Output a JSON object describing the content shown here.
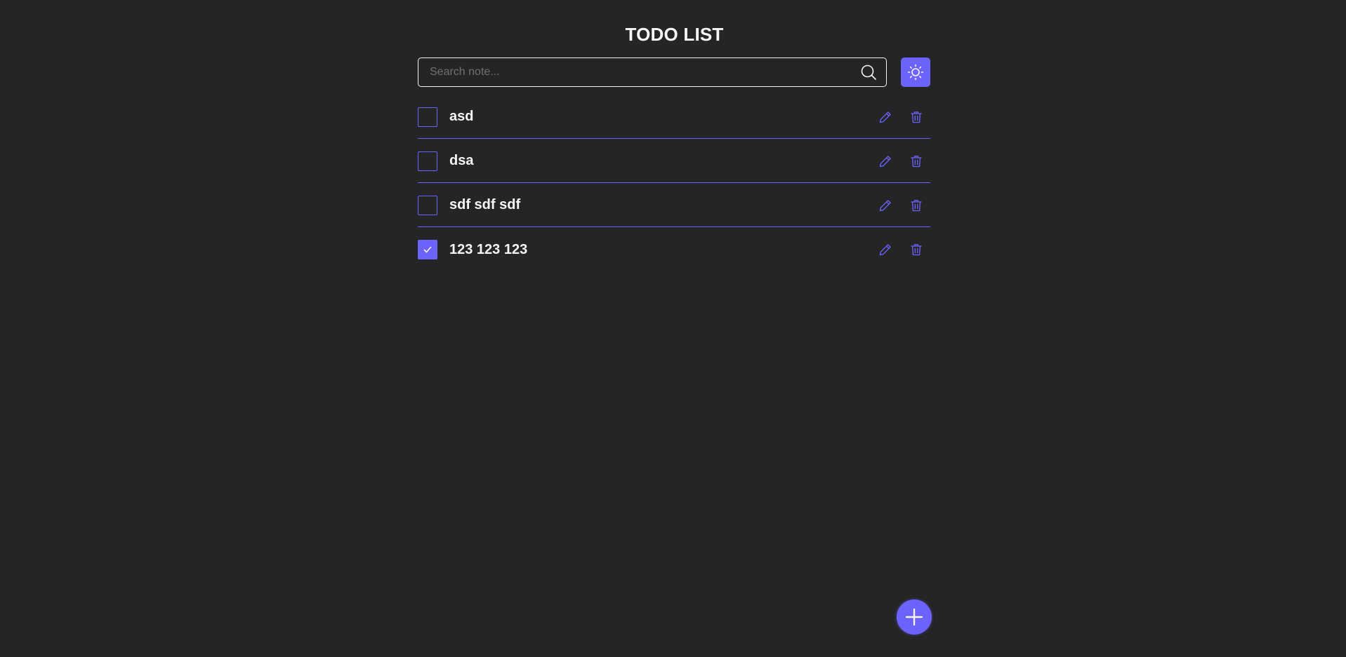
{
  "app": {
    "title": "TODO LIST"
  },
  "search": {
    "placeholder": "Search note...",
    "value": "",
    "icon": "search-icon"
  },
  "theme_toggle": {
    "icon": "sun-icon"
  },
  "todos": [
    {
      "label": "asd",
      "checked": false
    },
    {
      "label": "dsa",
      "checked": false
    },
    {
      "label": "sdf sdf sdf",
      "checked": false
    },
    {
      "label": "123 123 123",
      "checked": true
    }
  ],
  "item_actions": {
    "edit_icon": "pencil-icon",
    "delete_icon": "trash-icon"
  },
  "add_button": {
    "icon": "plus-icon"
  },
  "colors": {
    "background": "#252525",
    "accent": "#6c63ff",
    "text": "#f7f7f7",
    "placeholder": "#6f6f6f"
  }
}
